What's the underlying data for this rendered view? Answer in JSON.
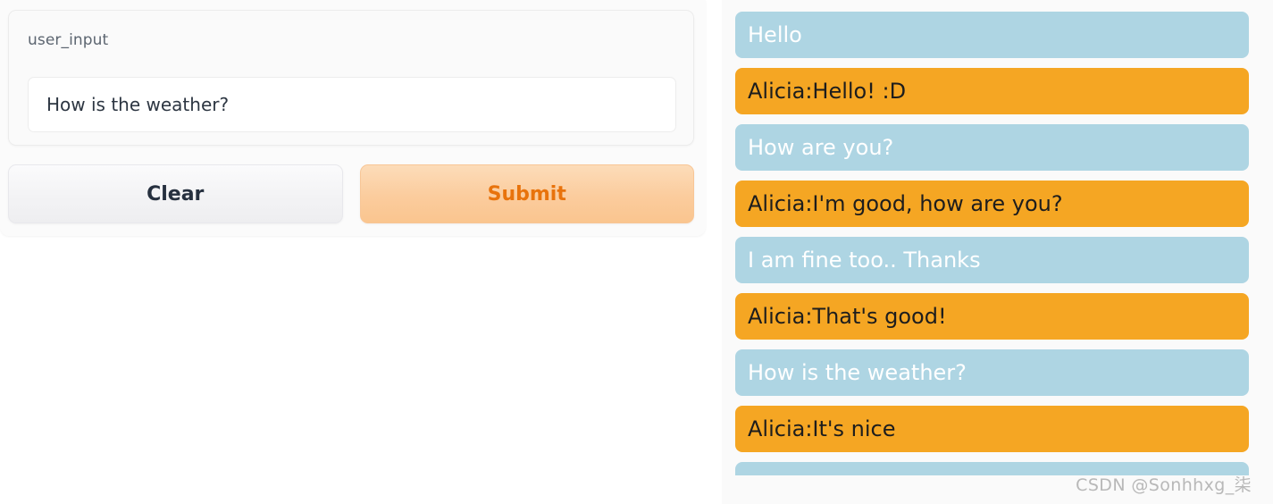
{
  "left_panel": {
    "input_block": {
      "label": "user_input",
      "value": "How is the weather?",
      "placeholder": ""
    },
    "buttons": {
      "clear_label": "Clear",
      "submit_label": "Submit"
    }
  },
  "chat_panel": {
    "messages": [
      {
        "role": "user",
        "text": "Hello",
        "clipped": false
      },
      {
        "role": "bot",
        "text": "Alicia:Hello! :D",
        "clipped": false
      },
      {
        "role": "user",
        "text": "How are you?",
        "clipped": false
      },
      {
        "role": "bot",
        "text": "Alicia:I'm good, how are you?",
        "clipped": false
      },
      {
        "role": "user",
        "text": "I am fine too.. Thanks",
        "clipped": false
      },
      {
        "role": "bot",
        "text": "Alicia:That's good!",
        "clipped": false
      },
      {
        "role": "user",
        "text": "How is the weather?",
        "clipped": false
      },
      {
        "role": "bot",
        "text": "Alicia:It's nice",
        "clipped": false
      },
      {
        "role": "user",
        "text": "",
        "clipped": true
      }
    ]
  },
  "watermark": {
    "text": "CSDN @Sonhhxg_柒"
  },
  "colors": {
    "user_bubble": "#aed5e3",
    "bot_bubble": "#f5a623",
    "user_text": "#ffffff",
    "bot_text": "#1d1d1d",
    "submit_text": "#e8730c",
    "clear_text": "#26303f",
    "label_text": "#5c6570",
    "panel_background": "#fafafa"
  }
}
